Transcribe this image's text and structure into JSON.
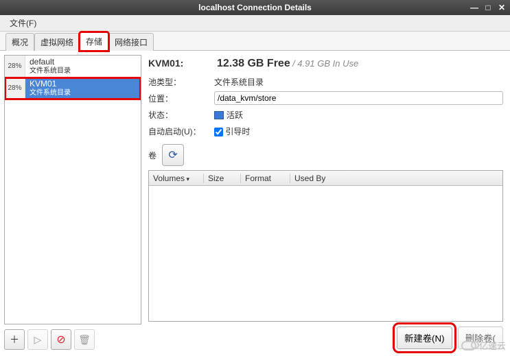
{
  "window": {
    "title": "localhost Connection Details"
  },
  "menu": {
    "file": "文件(F)"
  },
  "tabs": {
    "overview": "概况",
    "virtnet": "虚拟网络",
    "storage": "存储",
    "netif": "网络接口"
  },
  "pools": [
    {
      "pct": "28%",
      "name": "default",
      "sub": "文件系统目录"
    },
    {
      "pct": "28%",
      "name": "KVM01",
      "sub": "文件系统目录"
    }
  ],
  "details": {
    "title": "KVM01:",
    "free": "12.38 GB Free",
    "used": "/ 4.91 GB In Use",
    "type_label": "池类型：",
    "type_value": "文件系统目录",
    "loc_label": "位置：",
    "loc_value": "/data_kvm/store",
    "state_label": "状态：",
    "state_value": "活跃",
    "auto_label": "自动启动(U)：",
    "auto_value": "引导时",
    "vol_label": "卷"
  },
  "vol_headers": {
    "volumes": "Volumes",
    "size": "Size",
    "format": "Format",
    "usedby": "Used By"
  },
  "buttons": {
    "new_vol": "新建卷(N)",
    "del_vol": "删除卷("
  },
  "watermark": "亿速云"
}
